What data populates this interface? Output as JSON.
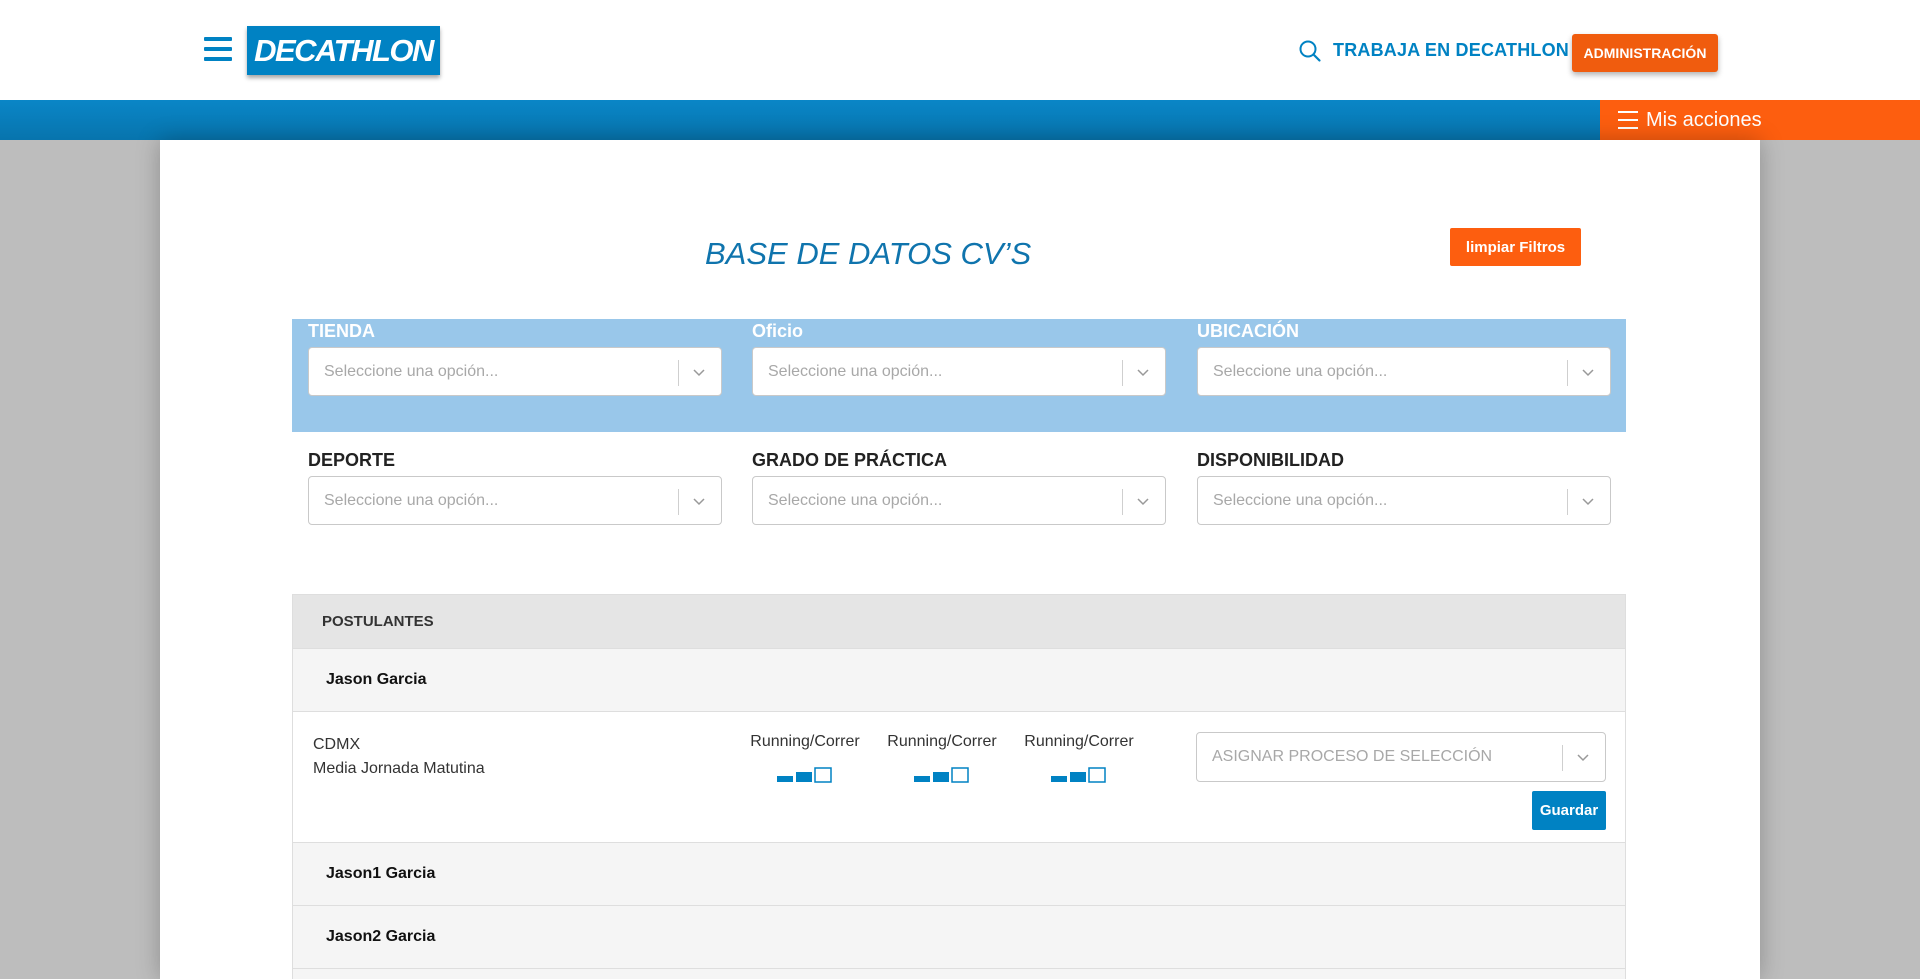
{
  "header": {
    "logo": "DECATHLON",
    "trabaja_link": "TRABAJA EN DECATHLON",
    "admin_button": "ADMINISTRACIÓN",
    "mis_acciones": "Mis acciones"
  },
  "main": {
    "title": "BASE DE DATOS CV’S",
    "clear_button": "limpiar Filtros"
  },
  "filters": [
    {
      "label": "TIENDA",
      "placeholder": "Seleccione una opción..."
    },
    {
      "label": "Oficio",
      "placeholder": "Seleccione una opción..."
    },
    {
      "label": "UBICACIÓN",
      "placeholder": "Seleccione una opción..."
    },
    {
      "label": "DEPORTE",
      "placeholder": "Seleccione una opción..."
    },
    {
      "label": "GRADO DE PRÁCTICA",
      "placeholder": "Seleccione una opción..."
    },
    {
      "label": "DISPONIBILIDAD",
      "placeholder": "Seleccione una opción..."
    }
  ],
  "postulantes": {
    "header": "POSTULANTES",
    "applicants": [
      {
        "name": "Jason Garcia"
      },
      {
        "name": "Jason1 Garcia"
      },
      {
        "name": "Jason2 Garcia"
      }
    ],
    "expanded": {
      "location": "CDMX",
      "availability": "Media Jornada Matutina",
      "sports": [
        {
          "name": "Running/Correr",
          "level": 2,
          "max_level": 3
        },
        {
          "name": "Running/Correr",
          "level": 2,
          "max_level": 3
        },
        {
          "name": "Running/Correr",
          "level": 2,
          "max_level": 3
        }
      ],
      "assign_placeholder": "ASIGNAR PROCESO DE SELECCIÓN",
      "save_button": "Guardar"
    }
  },
  "colors": {
    "brand_blue": "#0082c3",
    "accent_orange": "#fd5e0f",
    "filter_band": "#99c7ea"
  }
}
